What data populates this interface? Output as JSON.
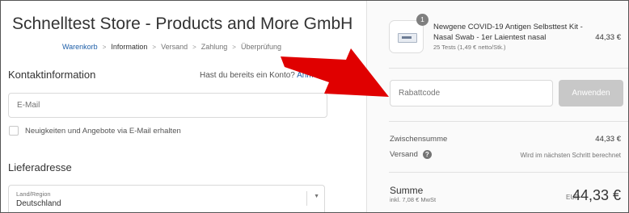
{
  "store": {
    "title": "Schnelltest Store - Products and More GmbH"
  },
  "breadcrumb": [
    {
      "label": "Warenkorb"
    },
    {
      "label": "Information"
    },
    {
      "label": "Versand"
    },
    {
      "label": "Zahlung"
    },
    {
      "label": "Überprüfung"
    }
  ],
  "contact": {
    "title": "Kontaktinformation",
    "login_prompt": "Hast du bereits ein Konto?",
    "login_link": "Anme",
    "email_placeholder": "E-Mail",
    "newsletter_label": "Neuigkeiten und Angebote via E-Mail erhalten"
  },
  "shipping": {
    "title": "Lieferadresse",
    "country_label": "Land/Region",
    "country_value": "Deutschland"
  },
  "cart": {
    "item": {
      "quantity": "1",
      "name": "Newgene COVID-19 Antigen Selbsttest Kit - Nasal Swab - 1er Laientest nasal",
      "variant": "25 Tests (1,49 € netto/Stk.)",
      "price": "44,33 €"
    },
    "discount": {
      "placeholder": "Rabattcode",
      "apply_label": "Anwenden"
    },
    "subtotal": {
      "label": "Zwischensumme",
      "value": "44,33 €"
    },
    "shipping": {
      "label": "Versand",
      "value": "Wird im nächsten Schritt berechnet"
    },
    "total": {
      "label": "Summe",
      "tax_note": "inkl. 7,08 € MwSt",
      "currency": "EUR",
      "value": "44,33 €"
    }
  },
  "colors": {
    "link": "#1f5fa8",
    "arrow": "#e00000",
    "apply_button": "#c8c8c8"
  },
  "icons": {
    "help": "question-circle-icon",
    "select": "chevron-down-icon",
    "annotation": "red-arrow-annotation"
  }
}
